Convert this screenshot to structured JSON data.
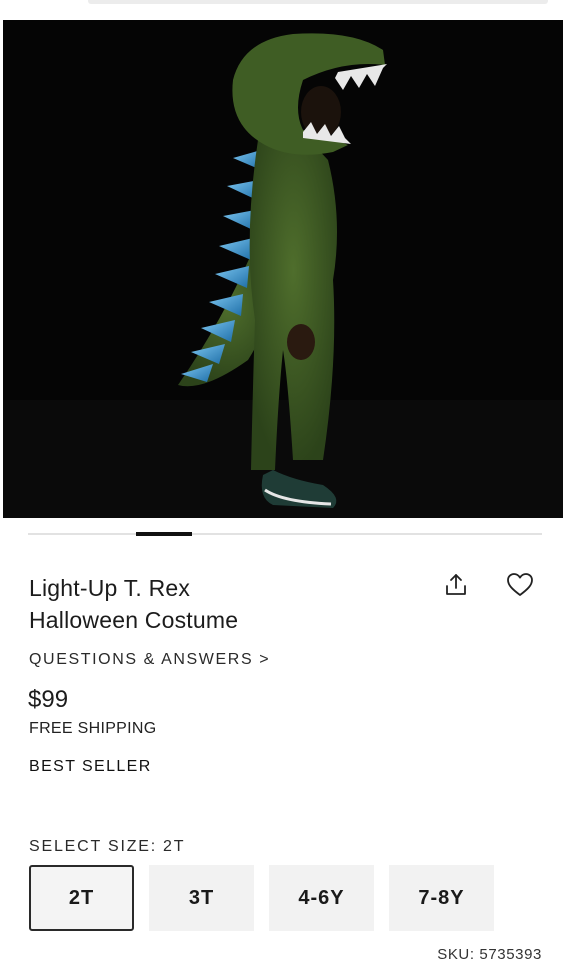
{
  "product": {
    "title_line1": "Light-Up T. Rex",
    "title_line2": "Halloween Costume",
    "image_alt": "Child wearing green dinosaur costume with blue spikes",
    "questions_link": "QUESTIONS & ANSWERS >",
    "price": "$99",
    "shipping": "FREE SHIPPING",
    "badge": "BEST SELLER",
    "sku": "SKU: 5735393"
  },
  "actions": {
    "share_icon": "share-icon",
    "favorite_icon": "heart-icon"
  },
  "carousel": {
    "active_index": 2,
    "total": 9
  },
  "size_selector": {
    "label": "SELECT SIZE:",
    "selected": "2T",
    "options": [
      "2T",
      "3T",
      "4-6Y",
      "7-8Y"
    ]
  },
  "colors": {
    "costume_green": "#3d5a24",
    "spike_blue": "#3fa0d8",
    "background": "#050505"
  }
}
